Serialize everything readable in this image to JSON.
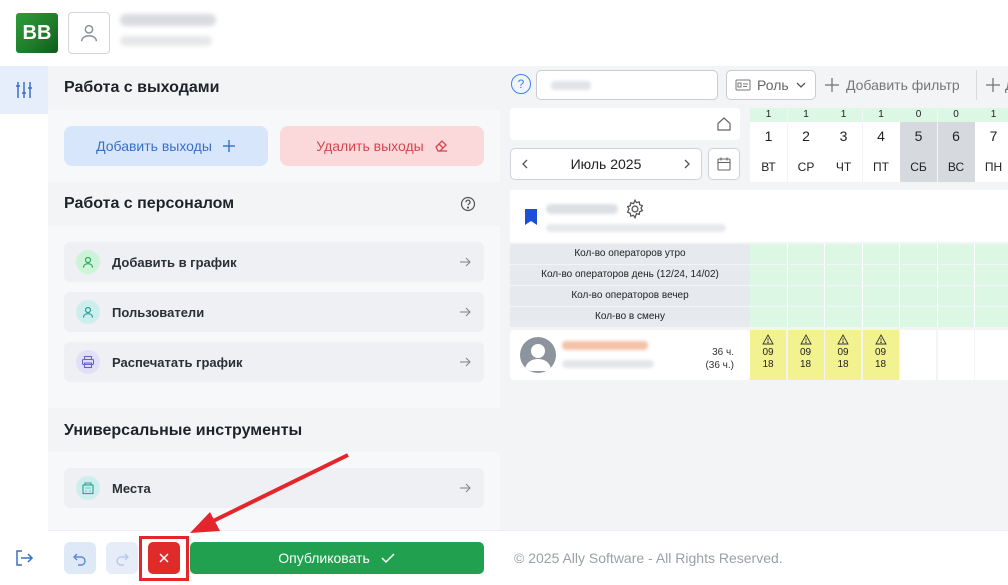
{
  "brand": {
    "logo_text": "BB"
  },
  "panel": {
    "sections": [
      {
        "title": "Работа с выходами"
      },
      {
        "title": "Работа с персоналом"
      },
      {
        "title": "Универсальные инструменты"
      }
    ],
    "add_button": "Добавить выходы",
    "delete_button": "Удалить выходы",
    "staff_tools": [
      {
        "label": "Добавить в график",
        "icon": "user-icon"
      },
      {
        "label": "Пользователи",
        "icon": "user-icon"
      },
      {
        "label": "Распечатать график",
        "icon": "printer-icon"
      }
    ],
    "universal_tools": [
      {
        "label": "Места",
        "icon": "building-icon"
      }
    ]
  },
  "bottom": {
    "publish_label": "Опубликовать",
    "copyright": "© 2025 Ally Software - All Rights Reserved."
  },
  "filters": {
    "help": "?",
    "role_label": "Роль",
    "add_filter": "Добавить фильтр",
    "add_more": "Д"
  },
  "calendar": {
    "month": "Июль 2025",
    "days": [
      {
        "count": "1",
        "num": "1",
        "wd": "ВТ",
        "weekend": false
      },
      {
        "count": "1",
        "num": "2",
        "wd": "СР",
        "weekend": false
      },
      {
        "count": "1",
        "num": "3",
        "wd": "ЧТ",
        "weekend": false
      },
      {
        "count": "1",
        "num": "4",
        "wd": "ПТ",
        "weekend": false
      },
      {
        "count": "0",
        "num": "5",
        "wd": "СБ",
        "weekend": true
      },
      {
        "count": "0",
        "num": "6",
        "wd": "ВС",
        "weekend": true
      },
      {
        "count": "1",
        "num": "7",
        "wd": "ПН",
        "weekend": false
      }
    ]
  },
  "stats": [
    "Кол-во операторов утро",
    "Кол-во операторов день (12/24, 14/02)",
    "Кол-во операторов вечер",
    "Кол-во в смену"
  ],
  "employee": {
    "hours": "36 ч.",
    "hours_sub": "(36 ч.)",
    "shifts": [
      {
        "start": "09",
        "end": "18"
      },
      {
        "start": "09",
        "end": "18"
      },
      {
        "start": "09",
        "end": "18"
      },
      {
        "start": "09",
        "end": "18"
      }
    ]
  },
  "colors": {
    "accent": "#3b6fc4",
    "publish": "#21a150",
    "danger": "#e02b2b",
    "shift": "#f2f291"
  }
}
